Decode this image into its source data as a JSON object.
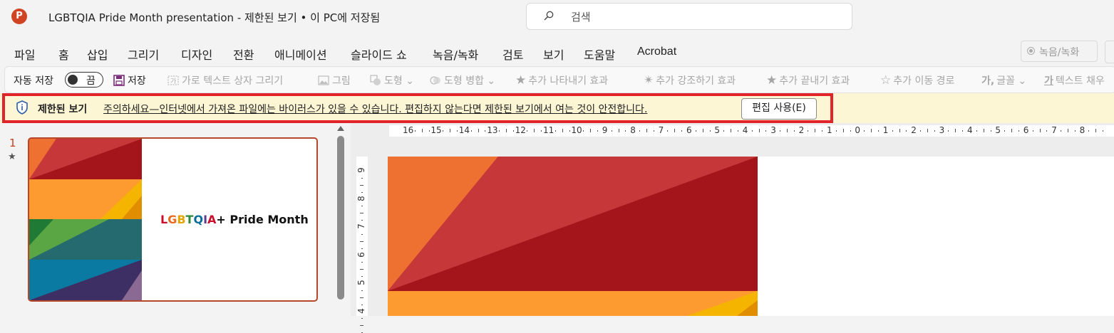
{
  "window": {
    "title": "LGBTQIA Pride Month presentation  -  제한된 보기 • 이 PC에 저장됨",
    "app_icon": "P"
  },
  "search": {
    "placeholder": "검색"
  },
  "menu": {
    "tabs": [
      "파일",
      "홈",
      "삽입",
      "그리기",
      "디자인",
      "전환",
      "애니메이션",
      "슬라이드 쇼",
      "녹음/녹화",
      "검토",
      "보기",
      "도움말",
      "Acrobat"
    ],
    "record_label": "녹음/녹화"
  },
  "ribbon": {
    "autosave_label": "자동 저장",
    "autosave_state": "끔",
    "save_label": "저장",
    "items": [
      "가로 텍스트 상자 그리기",
      "그림",
      "도형",
      "도형 병합",
      "추가 나타내기 효과",
      "추가 강조하기 효과",
      "추가 끝내기 효과",
      "추가 이동 경로",
      "글꼴",
      "텍스트 채우"
    ]
  },
  "protected_view": {
    "label": "제한된 보기",
    "message": "주의하세요—인터넷에서 가져온 파일에는 바이러스가 있을 수 있습니다. 편집하지 않는다면 제한된 보기에서 여는 것이 안전합니다.",
    "button": "편집 사용(E)",
    "colors": {
      "bar": "#fcf6d4",
      "highlight": "#e0242a"
    }
  },
  "thumbnails": {
    "slide_number": "1",
    "title_letters": [
      {
        "ch": "L",
        "color": "#c8102e"
      },
      {
        "ch": "G",
        "color": "#e86a1b"
      },
      {
        "ch": "B",
        "color": "#e3a600"
      },
      {
        "ch": "T",
        "color": "#2e8a3a"
      },
      {
        "ch": "Q",
        "color": "#0a6e98"
      },
      {
        "ch": "I",
        "color": "#5b3c8c"
      },
      {
        "ch": "A",
        "color": "#c8102e"
      }
    ],
    "title_rest": "+ Pride Month"
  },
  "rulers": {
    "horizontal": [
      "16",
      "15",
      "14",
      "13",
      "12",
      "11",
      "10",
      "9",
      "8",
      "7",
      "6",
      "5",
      "4",
      "3",
      "2",
      "1",
      "0",
      "1",
      "2",
      "3",
      "4",
      "5",
      "6",
      "7",
      "8"
    ],
    "vertical": [
      "9",
      "8",
      "7",
      "6",
      "5",
      "4"
    ]
  }
}
